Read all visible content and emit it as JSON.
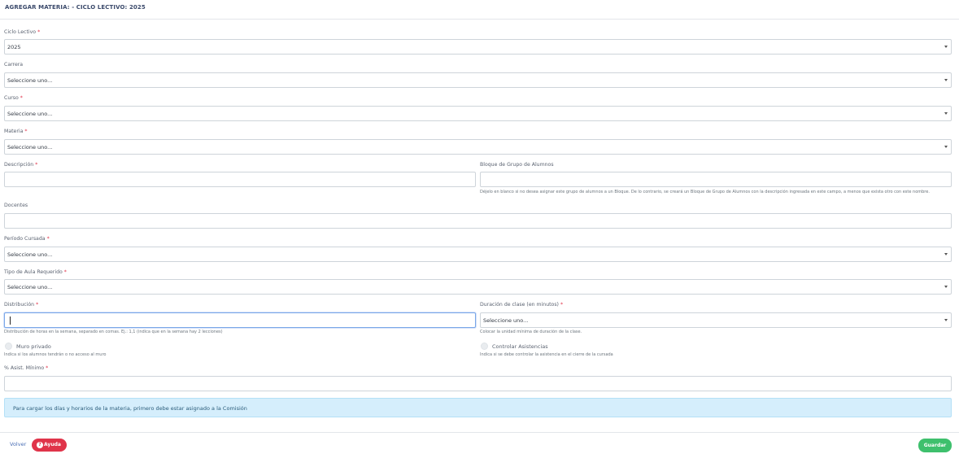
{
  "header": {
    "title": "AGREGAR MATERIA: - CICLO LECTIVO: 2025"
  },
  "required_mark": "*",
  "form": {
    "ciclo_lectivo": {
      "label": "Ciclo Lectivo",
      "value": "2025"
    },
    "carrera": {
      "label": "Carrera",
      "value": "Seleccione uno..."
    },
    "curso": {
      "label": "Curso",
      "value": "Seleccione uno..."
    },
    "materia": {
      "label": "Materia",
      "value": "Seleccione uno..."
    },
    "descripcion": {
      "label": "Descripción",
      "value": ""
    },
    "bloque": {
      "label": "Bloque de Grupo de Alumnos",
      "value": "",
      "help": "Déjelo en blanco si no desea asignar este grupo de alumnos a un Bloque. De lo contrario, se creará un Bloque de Grupo de Alumnos con la descripción ingresada en este campo, a menos que exista otro con este nombre."
    },
    "docentes": {
      "label": "Docentes",
      "value": ""
    },
    "periodo": {
      "label": "Período Cursada",
      "value": "Seleccione uno..."
    },
    "tipo_aula": {
      "label": "Tipo de Aula Requerido",
      "value": "Seleccione uno..."
    },
    "distribucion": {
      "label": "Distribución",
      "value": "",
      "help": "Distribución de horas en la semana, separado en comas. Ej.: 1,1 (indica que en la semana hay 2 lecciones)"
    },
    "duracion": {
      "label": "Duración de clase (en minutos)",
      "value": "Seleccione uno...",
      "help": "Colocar la unidad mínima de duración de la clase."
    },
    "muro_privado": {
      "label": "Muro privado",
      "checked": false,
      "help": "Indica si los alumnos tendrán o no acceso al muro"
    },
    "controlar_asistencias": {
      "label": "Controlar Asistencias",
      "checked": false,
      "help": "Indica si se debe controlar la asistencia en el cierre de la cursada"
    },
    "asistencia_minima": {
      "label": "% Asist. Mínimo",
      "value": ""
    }
  },
  "alert": {
    "text": "Para cargar los días y horarios de la materia, primero debe estar asignado a la Comisión"
  },
  "footer": {
    "back_label": "Volver",
    "help_label": "Ayuda",
    "help_icon": "question-circle-icon",
    "save_label": "Guardar"
  },
  "colors": {
    "accent": "#3b4a6b",
    "danger": "#e0344a",
    "success": "#3ec06d",
    "info_bg": "#d5eefc"
  }
}
